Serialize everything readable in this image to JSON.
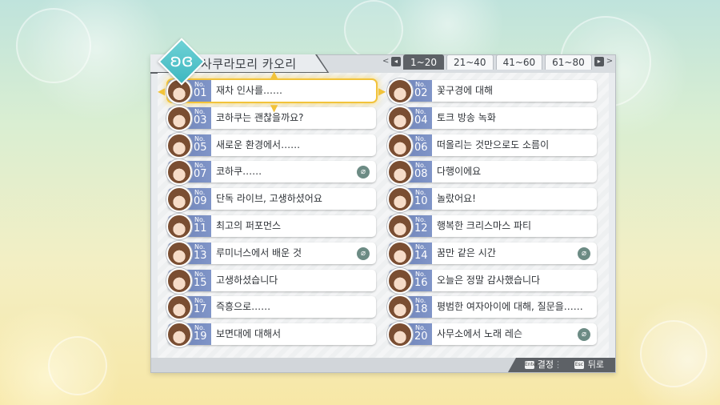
{
  "character_name": "사쿠라모리 카오리",
  "tabs": {
    "prev_key": "◂",
    "next_key": "▸",
    "items": [
      {
        "label": "1~20"
      },
      {
        "label": "21~40"
      },
      {
        "label": "41~60"
      },
      {
        "label": "61~80"
      }
    ],
    "active_index": 0
  },
  "entries": [
    {
      "no": "No.",
      "num": "01",
      "title": "재차 인사를……",
      "has_clip": false
    },
    {
      "no": "No.",
      "num": "02",
      "title": "꽃구경에 대해",
      "has_clip": false
    },
    {
      "no": "No.",
      "num": "03",
      "title": "코하쿠는 괜찮을까요?",
      "has_clip": false
    },
    {
      "no": "No.",
      "num": "04",
      "title": "토크 방송 녹화",
      "has_clip": false
    },
    {
      "no": "No.",
      "num": "05",
      "title": "새로운 환경에서……",
      "has_clip": false
    },
    {
      "no": "No.",
      "num": "06",
      "title": "떠올리는 것만으로도 소름이",
      "has_clip": false
    },
    {
      "no": "No.",
      "num": "07",
      "title": "코하쿠……",
      "has_clip": true
    },
    {
      "no": "No.",
      "num": "08",
      "title": "다행이에요",
      "has_clip": false
    },
    {
      "no": "No.",
      "num": "09",
      "title": "단독 라이브, 고생하셨어요",
      "has_clip": false
    },
    {
      "no": "No.",
      "num": "10",
      "title": "놀랐어요!",
      "has_clip": false
    },
    {
      "no": "No.",
      "num": "11",
      "title": "최고의 퍼포먼스",
      "has_clip": false
    },
    {
      "no": "No.",
      "num": "12",
      "title": "행복한 크리스마스 파티",
      "has_clip": false
    },
    {
      "no": "No.",
      "num": "13",
      "title": "루미너스에서 배운 것",
      "has_clip": true
    },
    {
      "no": "No.",
      "num": "14",
      "title": "꿈만 같은 시간",
      "has_clip": true
    },
    {
      "no": "No.",
      "num": "15",
      "title": "고생하셨습니다",
      "has_clip": false
    },
    {
      "no": "No.",
      "num": "16",
      "title": "오늘은 정말 감사했습니다",
      "has_clip": false
    },
    {
      "no": "No.",
      "num": "17",
      "title": "즉흥으로……",
      "has_clip": false
    },
    {
      "no": "No.",
      "num": "18",
      "title": "평범한 여자아이에 대해, 질문을……",
      "has_clip": false
    },
    {
      "no": "No.",
      "num": "19",
      "title": "보면대에 대해서",
      "has_clip": false
    },
    {
      "no": "No.",
      "num": "20",
      "title": "사무소에서 노래 레슨",
      "has_clip": true
    }
  ],
  "selected_index": 0,
  "footer": {
    "confirm_key": "Enter",
    "confirm_label": "결정",
    "back_key": "Esc",
    "back_label": "뒤로"
  },
  "colors": {
    "accent_gold": "#f2c33a",
    "number_block": "#6a7fb4",
    "panel_dark": "#5d6166",
    "emblem": "#3fb7c0"
  },
  "icons": {
    "emblem": "butterfly-emblem-icon",
    "clip": "paperclip-icon"
  }
}
